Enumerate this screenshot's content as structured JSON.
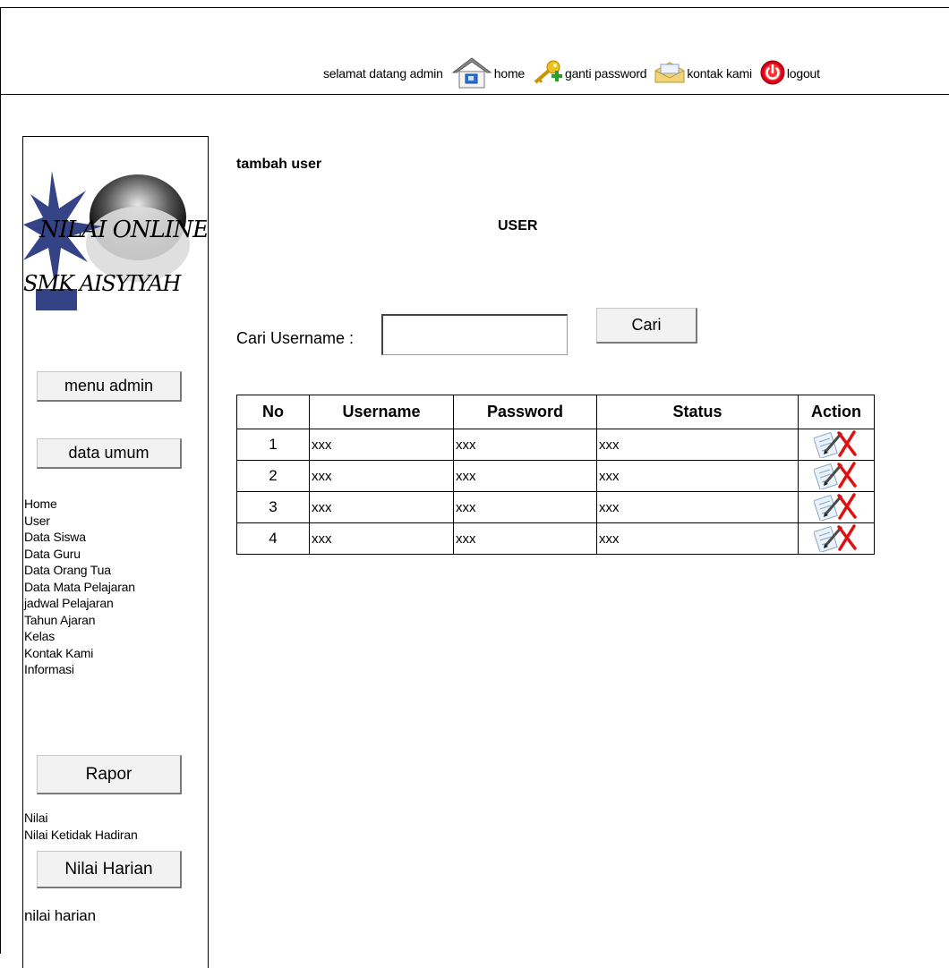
{
  "header": {
    "greeting": "selamat datang admin",
    "nav": [
      {
        "label": "home",
        "icon": "home-icon"
      },
      {
        "label": "ganti password",
        "icon": "key-icon"
      },
      {
        "label": "kontak kami",
        "icon": "mail-icon"
      },
      {
        "label": "logout",
        "icon": "power-icon"
      }
    ]
  },
  "sidebar": {
    "logo_text_line1": "NILAI ONLINE",
    "logo_text_line2": "SMK AISYIYAH",
    "buttons": {
      "menu_admin": "menu admin",
      "data_umum": "data umum",
      "rapor": "Rapor",
      "nilai_harian": "Nilai Harian"
    },
    "data_umum_links": [
      "Home",
      "User",
      "Data Siswa",
      "Data Guru",
      "Data Orang Tua",
      "Data Mata Pelajaran",
      "jadwal Pelajaran",
      "Tahun Ajaran",
      "Kelas",
      "Kontak Kami",
      "Informasi"
    ],
    "rapor_links": [
      "Nilai",
      "Nilai Ketidak Hadiran"
    ],
    "nilai_harian_links": [
      "nilai harian"
    ]
  },
  "main": {
    "add_link": "tambah user",
    "title": "USER",
    "search": {
      "label": "Cari Username :",
      "value": "",
      "placeholder": "",
      "button": "Cari"
    },
    "table": {
      "headers": [
        "No",
        "Username",
        "Password",
        "Status",
        "Action"
      ],
      "rows": [
        {
          "no": "1",
          "username": "xxx",
          "password": "xxx",
          "status": "xxx"
        },
        {
          "no": "2",
          "username": "xxx",
          "password": "xxx",
          "status": "xxx"
        },
        {
          "no": "3",
          "username": "xxx",
          "password": "xxx",
          "status": "xxx"
        },
        {
          "no": "4",
          "username": "xxx",
          "password": "xxx",
          "status": "xxx"
        }
      ]
    }
  },
  "colors": {
    "delete": "#e01010",
    "button_bg": "#f2f2f2",
    "power": "#d8001a",
    "key": "#e8b000"
  }
}
